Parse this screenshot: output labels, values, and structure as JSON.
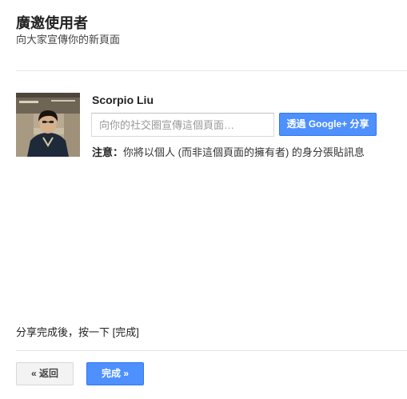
{
  "header": {
    "title": "廣邀使用者",
    "subtitle": "向大家宣傳你的新頁面"
  },
  "share": {
    "user_name": "Scorpio Liu",
    "input_placeholder": "向你的社交圈宣傳這個頁面…",
    "share_button_label": "透過 Google+ 分享",
    "note_label": "注意：",
    "note_text": "你將以個人 (而非這個頁面的擁有者) 的身分張貼訊息"
  },
  "footer": {
    "hint": "分享完成後，按一下 [完成]",
    "back_label": "« 返回",
    "done_label": "完成 »"
  },
  "colors": {
    "accent": "#4d90fe",
    "accent_border": "#3079ed"
  },
  "icons": {
    "avatar": "user-profile-photo"
  }
}
